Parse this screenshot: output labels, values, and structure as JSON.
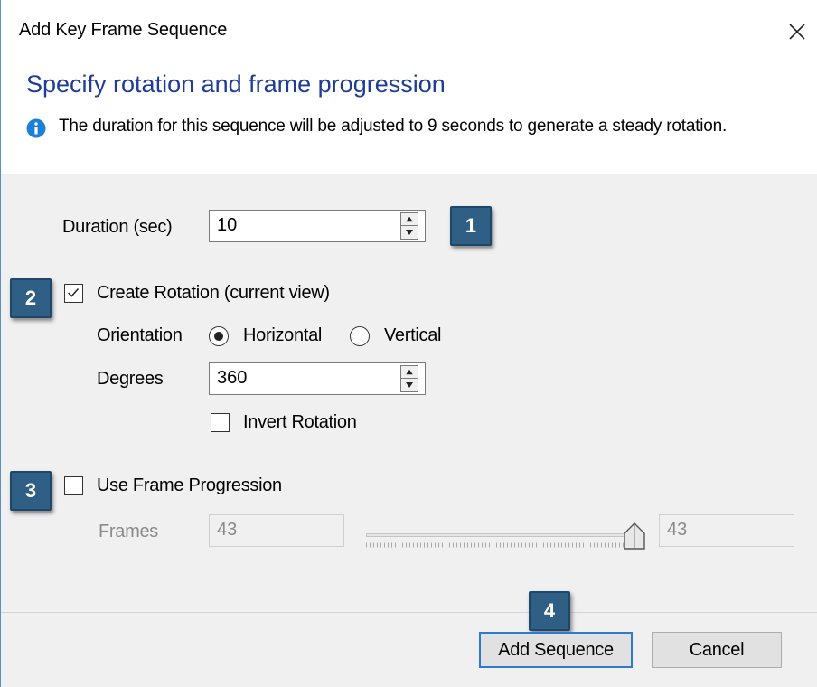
{
  "window": {
    "title": "Add Key Frame Sequence"
  },
  "header": {
    "heading": "Specify rotation and frame progression",
    "info": "The duration for this sequence will be adjusted to 9 seconds to generate a steady rotation."
  },
  "duration": {
    "label": "Duration (sec)",
    "value": "10"
  },
  "rotation": {
    "checkbox_label": "Create Rotation (current view)",
    "checked": true,
    "orientation_label": "Orientation",
    "options": [
      "Horizontal",
      "Vertical"
    ],
    "selected": "Horizontal",
    "degrees_label": "Degrees",
    "degrees_value": "360",
    "invert_label": "Invert Rotation",
    "invert_checked": false
  },
  "frames": {
    "checkbox_label": "Use Frame Progression",
    "checked": false,
    "frames_label": "Frames",
    "frames_value": "43",
    "slider_value": "43",
    "slider_position": 1.0
  },
  "buttons": {
    "add": "Add Sequence",
    "cancel": "Cancel"
  },
  "callouts": [
    "1",
    "2",
    "3",
    "4"
  ],
  "colors": {
    "heading": "#1e3c9a",
    "callout": "#2f5f85",
    "default_button_border": "#2b7bd1",
    "info_icon": "#1e7fd8"
  },
  "icons": {
    "close": "close-icon",
    "info": "info-icon",
    "spinner": "spinner-arrows-icon",
    "checkmark": "checkmark-icon",
    "slider_thumb": "slider-thumb-icon"
  }
}
